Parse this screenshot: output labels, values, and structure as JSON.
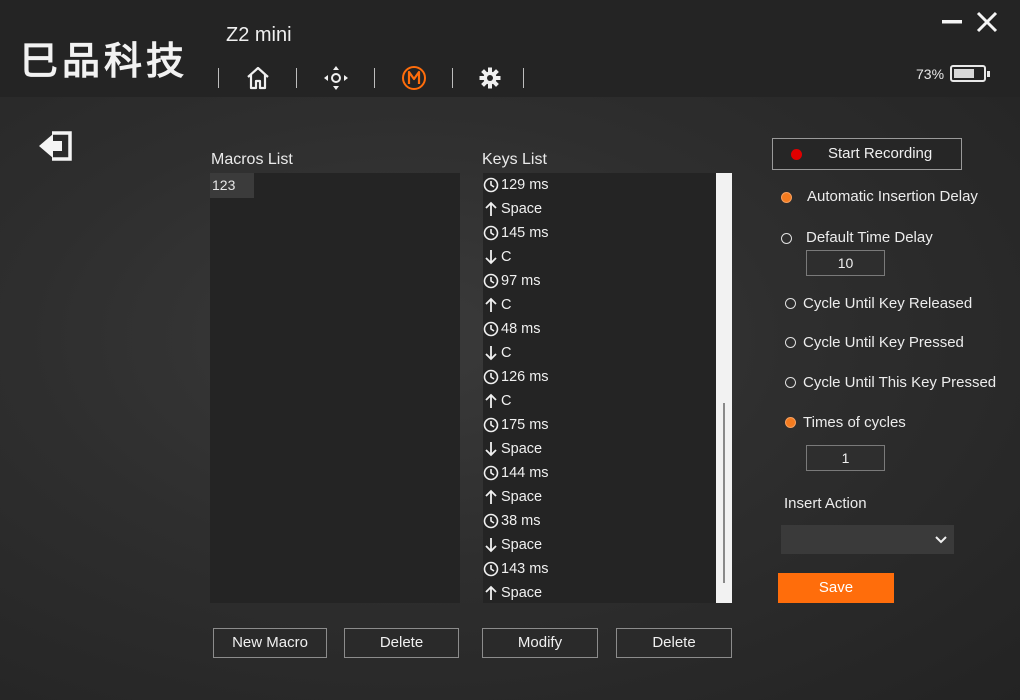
{
  "app": {
    "logo_text": "巳品科技",
    "device_name": "Z2 mini",
    "battery_text": "73%",
    "battery_level": 0.73,
    "accent_color": "#ff6d0b"
  },
  "nav": {
    "icons": [
      "home-icon",
      "dpad-icon",
      "macro-icon",
      "gear-icon"
    ],
    "active": "macro-icon"
  },
  "window": {
    "minimize_icon": "minimize-icon",
    "close_icon": "close-icon"
  },
  "macros": {
    "title": "Macros List",
    "items": [
      "123"
    ],
    "new_label": "New Macro",
    "delete_label": "Delete"
  },
  "keys": {
    "title": "Keys List",
    "items": [
      {
        "icon": "clock-icon",
        "text": "129 ms"
      },
      {
        "icon": "key-up-icon",
        "text": "Space"
      },
      {
        "icon": "clock-icon",
        "text": "145 ms"
      },
      {
        "icon": "key-down-icon",
        "text": "C"
      },
      {
        "icon": "clock-icon",
        "text": "97 ms"
      },
      {
        "icon": "key-up-icon",
        "text": "C"
      },
      {
        "icon": "clock-icon",
        "text": "48 ms"
      },
      {
        "icon": "key-down-icon",
        "text": "C"
      },
      {
        "icon": "clock-icon",
        "text": "126 ms"
      },
      {
        "icon": "key-up-icon",
        "text": "C"
      },
      {
        "icon": "clock-icon",
        "text": "175 ms"
      },
      {
        "icon": "key-down-icon",
        "text": "Space"
      },
      {
        "icon": "clock-icon",
        "text": "144 ms"
      },
      {
        "icon": "key-up-icon",
        "text": "Space"
      },
      {
        "icon": "clock-icon",
        "text": "38 ms"
      },
      {
        "icon": "key-down-icon",
        "text": "Space"
      },
      {
        "icon": "clock-icon",
        "text": "143 ms"
      },
      {
        "icon": "key-up-icon",
        "text": "Space"
      }
    ],
    "modify_label": "Modify",
    "delete_label": "Delete"
  },
  "settings": {
    "record_label": "Start Recording",
    "auto_delay_label": "Automatic Insertion Delay",
    "default_delay_label": "Default Time Delay",
    "default_delay_value": "10",
    "cycle_released_label": "Cycle Until Key Released",
    "cycle_pressed_label": "Cycle Until Key Pressed",
    "cycle_this_label": "Cycle Until This Key Pressed",
    "times_label": "Times of cycles",
    "times_value": "1",
    "insert_action_label": "Insert Action",
    "insert_action_value": "",
    "save_label": "Save",
    "selected_delay": "auto",
    "selected_cycle": "times"
  }
}
